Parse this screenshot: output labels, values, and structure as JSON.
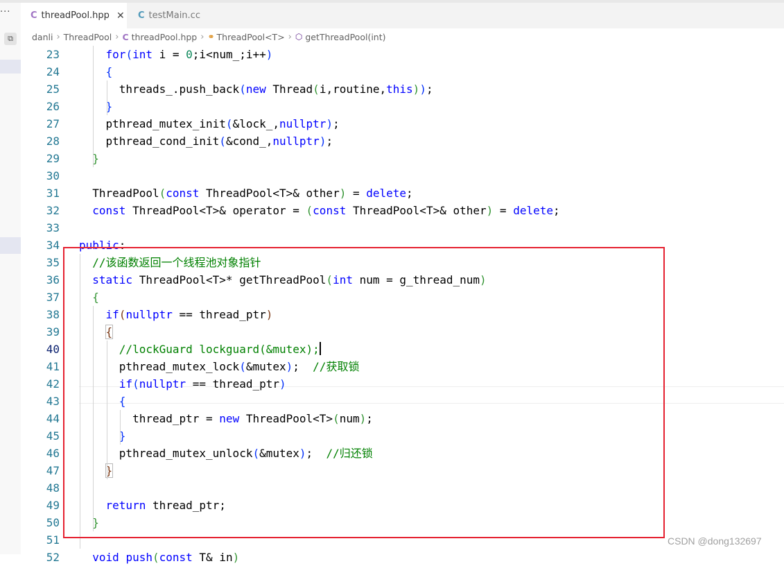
{
  "activity_bar": {
    "overflow_label": "···"
  },
  "tabs": [
    {
      "label": "threadPool.hpp",
      "active": true,
      "close": "✕"
    },
    {
      "label": "testMain.cc",
      "active": false
    }
  ],
  "breadcrumb": [
    "danli",
    "ThreadPool",
    "threadPool.hpp",
    "ThreadPool<T>",
    "getThreadPool(int)"
  ],
  "editor": {
    "current_line": 40,
    "lines": [
      {
        "n": "23",
        "tokens": [
          [
            "    ",
            ""
          ],
          [
            "for",
            "kw"
          ],
          [
            "(",
            "b1"
          ],
          [
            "int",
            "kw"
          ],
          [
            " i = ",
            ""
          ],
          [
            "0",
            "num"
          ],
          [
            ";i<num_;i++",
            ""
          ],
          [
            ")",
            "b1"
          ]
        ]
      },
      {
        "n": "24",
        "tokens": [
          [
            "    ",
            ""
          ],
          [
            "{",
            "b1"
          ]
        ]
      },
      {
        "n": "25",
        "tokens": [
          [
            "      threads_.push_back",
            ""
          ],
          [
            "(",
            "b1"
          ],
          [
            "new",
            "kw"
          ],
          [
            " Thread",
            ""
          ],
          [
            "(",
            "b2"
          ],
          [
            "i,routine,",
            ""
          ],
          [
            "this",
            "kw"
          ],
          [
            ")",
            "b2"
          ],
          [
            ")",
            "b1"
          ],
          [
            ";",
            ""
          ]
        ]
      },
      {
        "n": "26",
        "tokens": [
          [
            "    ",
            ""
          ],
          [
            "}",
            "b1"
          ]
        ]
      },
      {
        "n": "27",
        "tokens": [
          [
            "    pthread_mutex_init",
            ""
          ],
          [
            "(",
            "b1"
          ],
          [
            "&lock_,",
            ""
          ],
          [
            "nullptr",
            "kw"
          ],
          [
            ")",
            "b1"
          ],
          [
            ";",
            ""
          ]
        ]
      },
      {
        "n": "28",
        "tokens": [
          [
            "    pthread_cond_init",
            ""
          ],
          [
            "(",
            "b1"
          ],
          [
            "&cond_,",
            ""
          ],
          [
            "nullptr",
            "kw"
          ],
          [
            ")",
            "b1"
          ],
          [
            ";",
            ""
          ]
        ]
      },
      {
        "n": "29",
        "tokens": [
          [
            "  ",
            ""
          ],
          [
            "}",
            "b2"
          ]
        ]
      },
      {
        "n": "30",
        "tokens": []
      },
      {
        "n": "31",
        "tokens": [
          [
            "  ThreadPool",
            ""
          ],
          [
            "(",
            "b2"
          ],
          [
            "const",
            "kw"
          ],
          [
            " ThreadPool<T>& other",
            ""
          ],
          [
            ")",
            "b2"
          ],
          [
            " = ",
            ""
          ],
          [
            "delete",
            "kw"
          ],
          [
            ";",
            ""
          ]
        ]
      },
      {
        "n": "32",
        "tokens": [
          [
            "  ",
            ""
          ],
          [
            "const",
            "kw"
          ],
          [
            " ThreadPool<T>& operator = ",
            ""
          ],
          [
            "(",
            "b2"
          ],
          [
            "const",
            "kw"
          ],
          [
            " ThreadPool<T>& other",
            ""
          ],
          [
            ")",
            "b2"
          ],
          [
            " = ",
            ""
          ],
          [
            "delete",
            "kw"
          ],
          [
            ";",
            ""
          ]
        ]
      },
      {
        "n": "33",
        "tokens": []
      },
      {
        "n": "34",
        "tokens": [
          [
            "public",
            "kw"
          ],
          [
            ":",
            ""
          ]
        ]
      },
      {
        "n": "35",
        "tokens": [
          [
            "  ",
            ""
          ],
          [
            "//该函数返回一个线程池对象指针",
            "cm"
          ]
        ]
      },
      {
        "n": "36",
        "tokens": [
          [
            "  ",
            ""
          ],
          [
            "static",
            "kw"
          ],
          [
            " ThreadPool<T>* getThreadPool",
            ""
          ],
          [
            "(",
            "b2"
          ],
          [
            "int",
            "kw"
          ],
          [
            " num = g_thread_num",
            ""
          ],
          [
            ")",
            "b2"
          ]
        ]
      },
      {
        "n": "37",
        "tokens": [
          [
            "  ",
            ""
          ],
          [
            "{",
            "b2"
          ]
        ]
      },
      {
        "n": "38",
        "tokens": [
          [
            "    ",
            ""
          ],
          [
            "if",
            "kw"
          ],
          [
            "(",
            "b3"
          ],
          [
            "nullptr",
            "kw"
          ],
          [
            " == thread_ptr",
            ""
          ],
          [
            ")",
            "b3"
          ]
        ]
      },
      {
        "n": "39",
        "tokens": [
          [
            "    ",
            ""
          ],
          [
            "{",
            "b3hl"
          ]
        ]
      },
      {
        "n": "40",
        "tokens": [
          [
            "      ",
            ""
          ],
          [
            "//lockGuard lockguard(&mutex);",
            "cm"
          ],
          [
            "CURSOR",
            ""
          ]
        ]
      },
      {
        "n": "41",
        "tokens": [
          [
            "      pthread_mutex_lock",
            ""
          ],
          [
            "(",
            "b1"
          ],
          [
            "&mutex",
            ""
          ],
          [
            ")",
            "b1"
          ],
          [
            ";  ",
            ""
          ],
          [
            "//获取锁",
            "cm"
          ]
        ]
      },
      {
        "n": "42",
        "tokens": [
          [
            "      ",
            ""
          ],
          [
            "if",
            "kw"
          ],
          [
            "(",
            "b1"
          ],
          [
            "nullptr",
            "kw"
          ],
          [
            " == thread_ptr",
            ""
          ],
          [
            ")",
            "b1"
          ]
        ]
      },
      {
        "n": "43",
        "tokens": [
          [
            "      ",
            ""
          ],
          [
            "{",
            "b1"
          ]
        ]
      },
      {
        "n": "44",
        "tokens": [
          [
            "        thread_ptr = ",
            ""
          ],
          [
            "new",
            "kw"
          ],
          [
            " ThreadPool<T>",
            ""
          ],
          [
            "(",
            "b2"
          ],
          [
            "num",
            ""
          ],
          [
            ")",
            "b2"
          ],
          [
            ";",
            ""
          ]
        ]
      },
      {
        "n": "45",
        "tokens": [
          [
            "      ",
            ""
          ],
          [
            "}",
            "b1"
          ]
        ]
      },
      {
        "n": "46",
        "tokens": [
          [
            "      pthread_mutex_unlock",
            ""
          ],
          [
            "(",
            "b1"
          ],
          [
            "&mutex",
            ""
          ],
          [
            ")",
            "b1"
          ],
          [
            ";  ",
            ""
          ],
          [
            "//归还锁",
            "cm"
          ]
        ]
      },
      {
        "n": "47",
        "tokens": [
          [
            "    ",
            ""
          ],
          [
            "}",
            "b3hl"
          ]
        ]
      },
      {
        "n": "48",
        "tokens": []
      },
      {
        "n": "49",
        "tokens": [
          [
            "    ",
            ""
          ],
          [
            "return",
            "kw"
          ],
          [
            " thread_ptr;",
            ""
          ]
        ]
      },
      {
        "n": "50",
        "tokens": [
          [
            "  ",
            ""
          ],
          [
            "}",
            "b2"
          ]
        ]
      },
      {
        "n": "51",
        "tokens": []
      },
      {
        "n": "52",
        "tokens": [
          [
            "  ",
            ""
          ],
          [
            "void",
            "kw"
          ],
          [
            " ",
            ""
          ],
          [
            "push",
            "kw"
          ],
          [
            "(",
            "b2"
          ],
          [
            "const",
            "kw"
          ],
          [
            " T& in",
            ""
          ],
          [
            ")",
            "b2"
          ]
        ]
      }
    ]
  },
  "watermark": "CSDN @dong132697",
  "colors": {
    "highlight_box": "#e5202f",
    "line_number": "#237893",
    "keyword": "#0000ff",
    "comment": "#008000"
  }
}
